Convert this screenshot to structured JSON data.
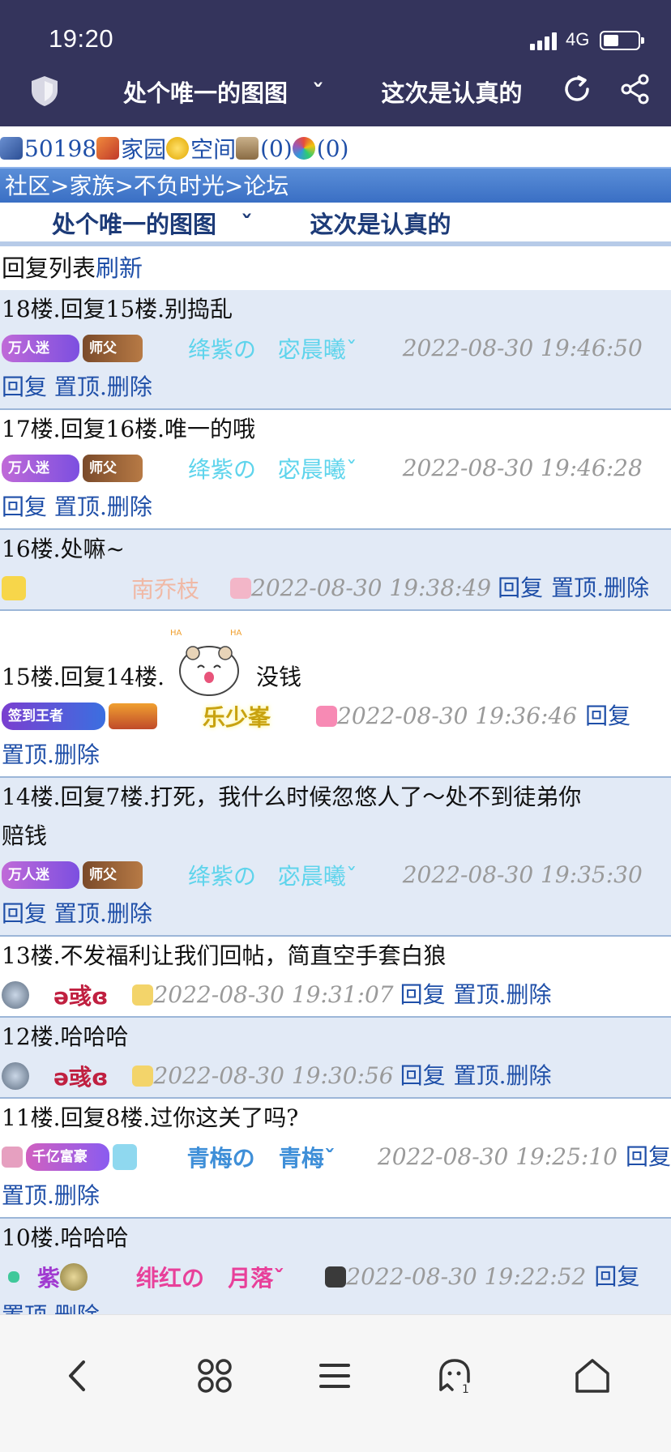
{
  "status": {
    "time": "19:20",
    "network": "4G"
  },
  "header": {
    "title": "处个唯一的图图   ˇ       这次是认真的",
    "shield_icon": "shield-icon",
    "refresh_icon": "refresh-icon",
    "share_icon": "share-icon"
  },
  "user_nav": {
    "id": "50198",
    "home": "家园",
    "space": "空间",
    "bank": "(0)",
    "lottery": "(0)"
  },
  "breadcrumb": "社区>家族>不负时光>论坛",
  "topic": "处个唯一的图图   ˇ       这次是认真的",
  "list_header": {
    "label": "回复列表",
    "refresh": "刷新"
  },
  "actions": {
    "reply": "回复",
    "pin": "置顶",
    "delete": "删除"
  },
  "badges": {
    "wanren": "万人迷",
    "shifu": "师父",
    "qiandao": "签到王者",
    "qianyi": "千亿富豪",
    "zi": "紫"
  },
  "posts": [
    {
      "text": "18楼.回复15楼.别捣乱",
      "user": "绛紫の   宓晨曦ˇ",
      "time": "2022-08-30 19:46:50"
    },
    {
      "text": "17楼.回复16楼.唯一的哦",
      "user": "绛紫の   宓晨曦ˇ",
      "time": "2022-08-30 19:46:28"
    },
    {
      "text": "16楼.处嘛~",
      "user": "南乔枝",
      "time": "2022-08-30 19:38:49"
    },
    {
      "text_before": "15楼.回复14楼.",
      "text_after": "没钱",
      "user": "乐少峯",
      "time": "2022-08-30 19:36:46"
    },
    {
      "text": "14楼.回复7楼.打死，我什么时候忽悠人了～处不到徒弟你",
      "text2": "赔钱",
      "user": "绛紫の   宓晨曦ˇ",
      "time": "2022-08-30 19:35:30"
    },
    {
      "text": "13楼.不发福利让我们回帖，简直空手套白狼",
      "user": "ə彧ɞ",
      "time": "2022-08-30 19:31:07"
    },
    {
      "text": "12楼.哈哈哈",
      "user": "ə彧ɞ",
      "time": "2022-08-30 19:30:56"
    },
    {
      "text": "11楼.回复8楼.过你这关了吗?",
      "user": "青梅の   青梅ˇ",
      "time": "2022-08-30 19:25:10"
    },
    {
      "text": "10楼.哈哈哈",
      "user": "绯红の   月落ˇ",
      "time": "2022-08-30 19:22:52"
    }
  ],
  "bottom_nav": [
    "back-icon",
    "apps-icon",
    "menu-icon",
    "assistant-icon",
    "home-icon"
  ],
  "colors": {
    "topbar": "#34345c",
    "link": "#1f4fa8",
    "shade": "#e2eaf6",
    "cyan_name": "#5fd4ec",
    "pink_name": "#e8409a"
  }
}
